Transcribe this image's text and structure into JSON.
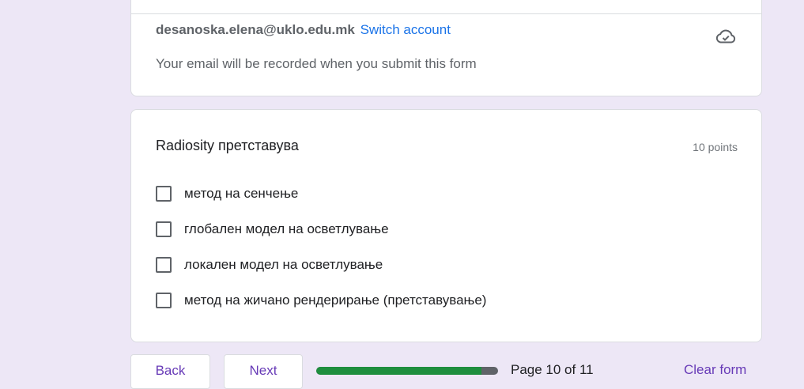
{
  "account": {
    "email": "desanoska.elena@uklo.edu.mk",
    "switch_label": "Switch account",
    "note": "Your email will be recorded when you submit this form",
    "icon": "cloud-done-icon"
  },
  "question": {
    "title": "Radiosity претставува",
    "points": "10 points",
    "options": [
      "метод на сенчење",
      "глобален модел на осветлување",
      "локален модел на осветлување",
      "метод на жичано рендерирање (претставување)"
    ]
  },
  "navigation": {
    "back_label": "Back",
    "next_label": "Next",
    "page_label": "Page 10 of 11",
    "progress_fraction": 0.909,
    "clear_label": "Clear form"
  },
  "colors": {
    "background": "#ede7f6",
    "accent": "#673ab7",
    "link": "#1a73e8",
    "progress": "#1e8e3e"
  }
}
